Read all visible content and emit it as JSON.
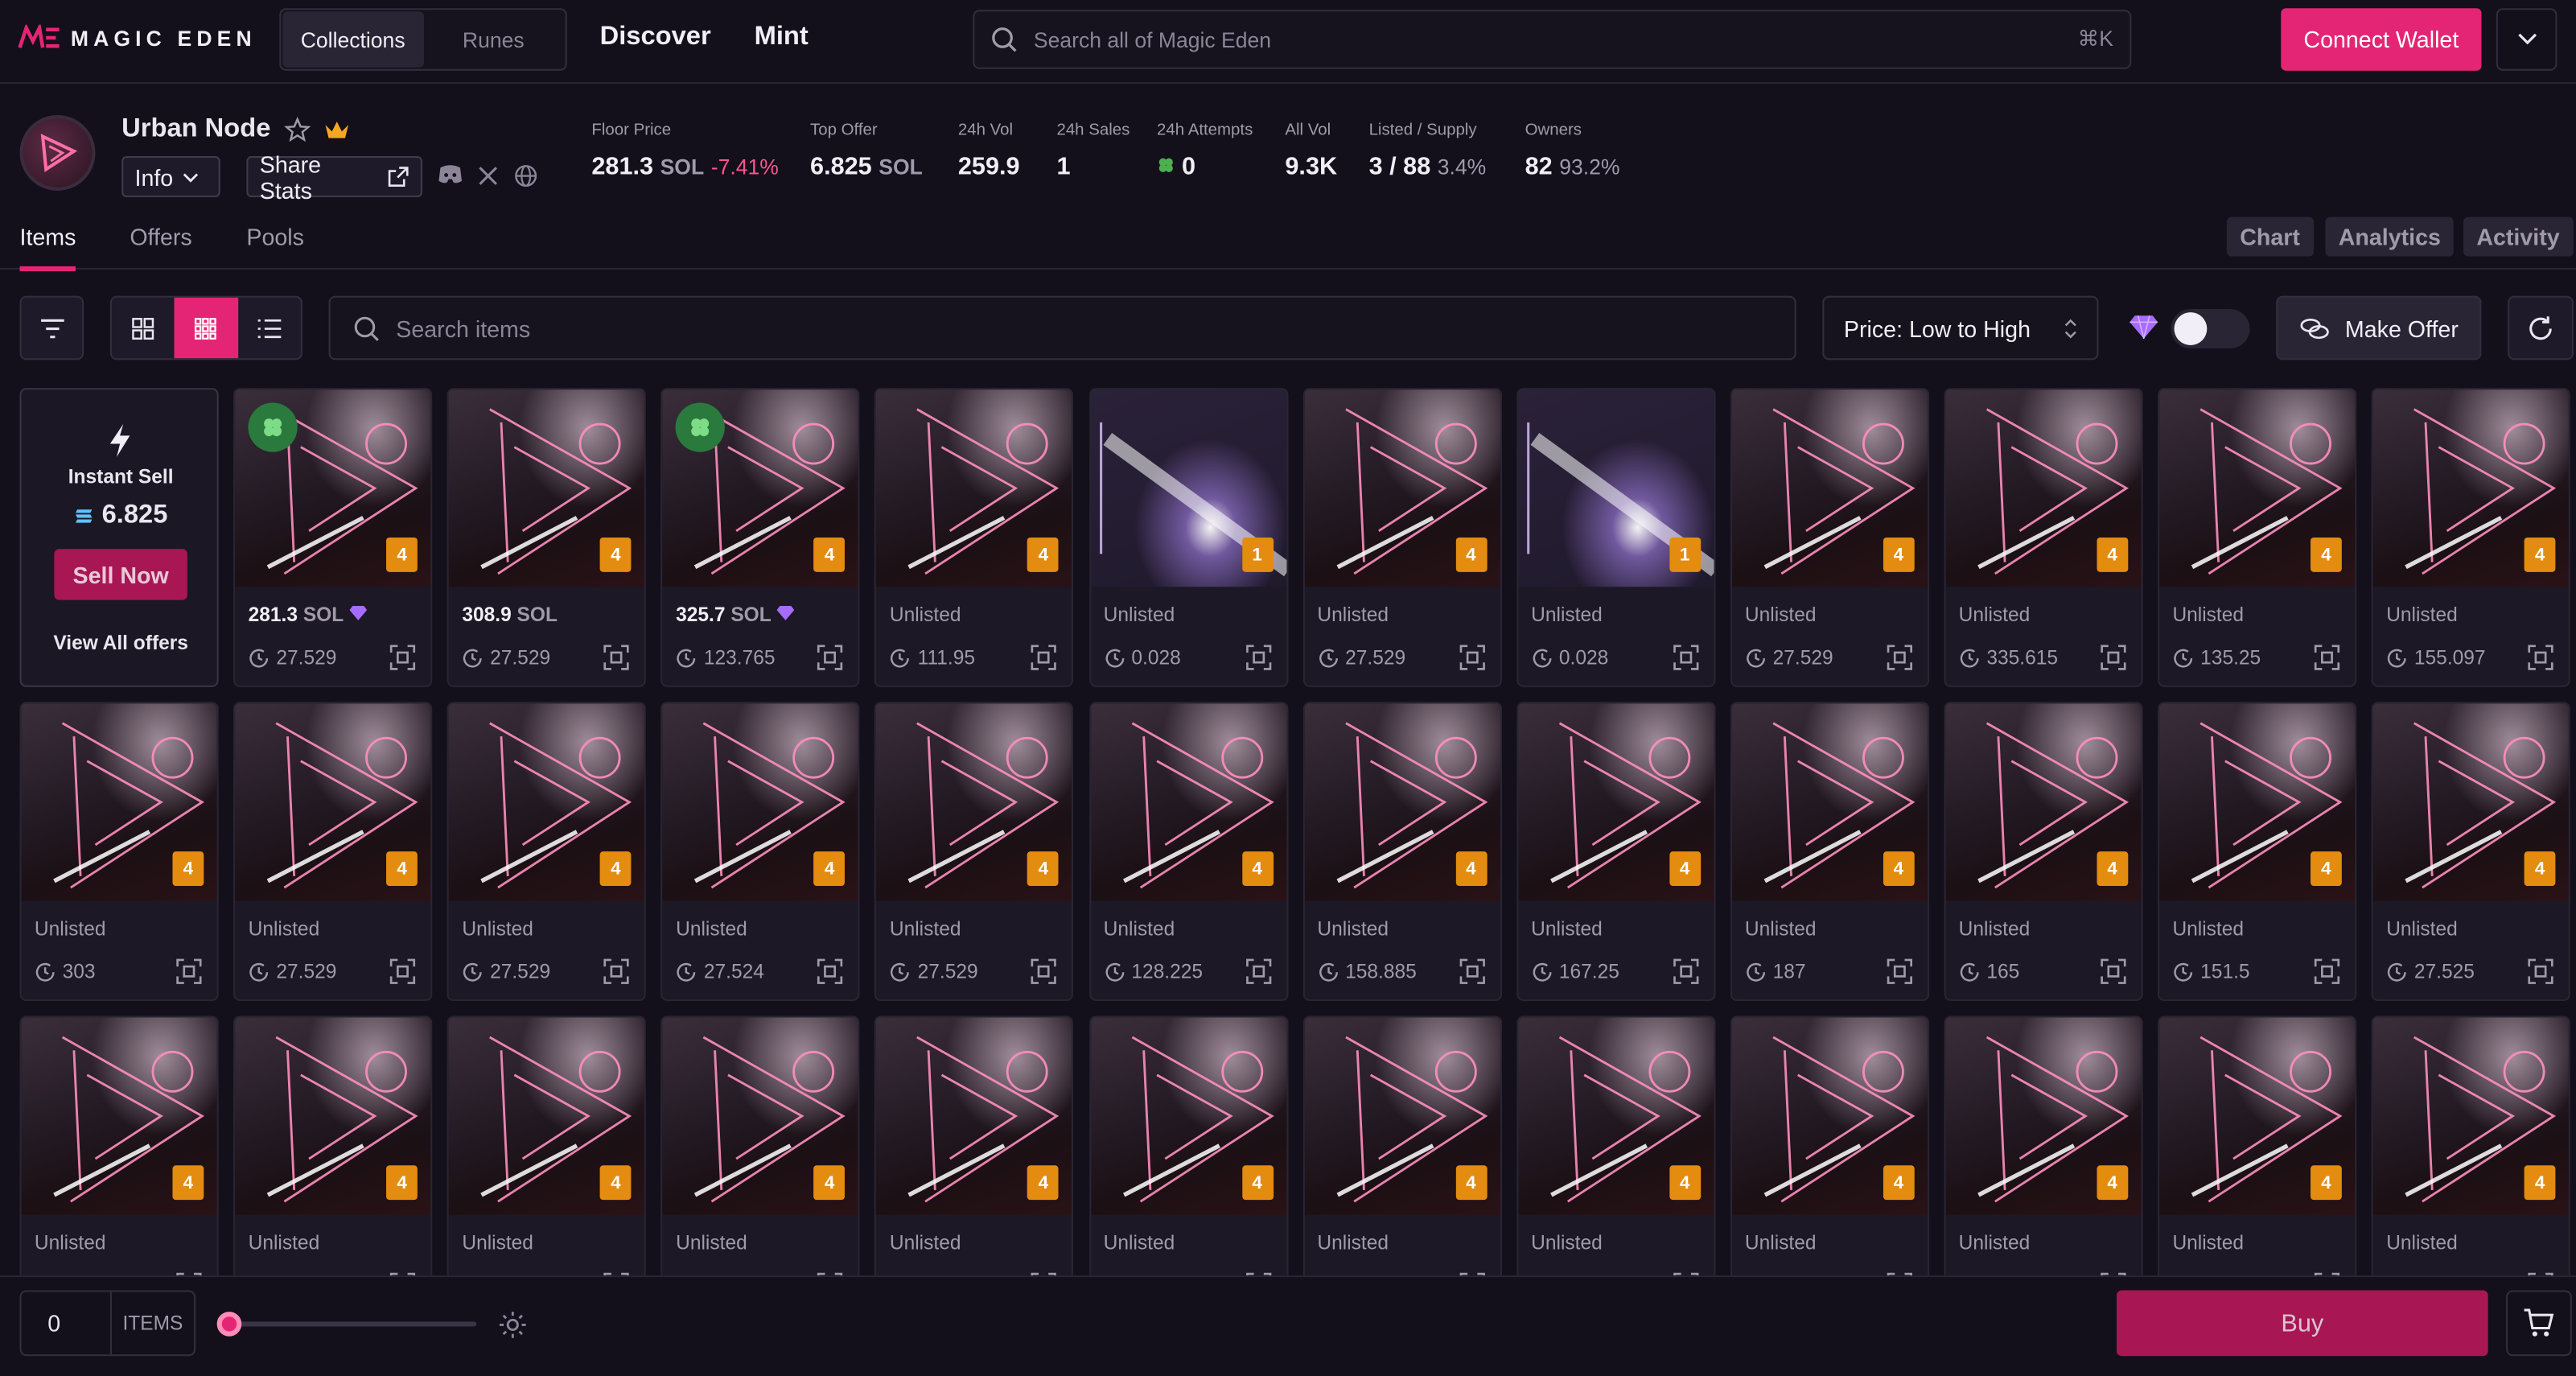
{
  "brand": {
    "name": "MAGIC EDEN"
  },
  "header": {
    "tabs": [
      "Collections",
      "Runes"
    ],
    "nav": [
      "Discover",
      "Mint"
    ],
    "search_placeholder": "Search all of Magic Eden",
    "search_shortcut": "⌘K",
    "connect_wallet": "Connect Wallet"
  },
  "collection": {
    "name": "Urban Node",
    "info_label": "Info",
    "share_label": "Share Stats",
    "stats": [
      {
        "label": "Floor Price",
        "value": "281.3",
        "unit": "SOL",
        "change": "-7.41%"
      },
      {
        "label": "Top Offer",
        "value": "6.825",
        "unit": "SOL"
      },
      {
        "label": "24h Vol",
        "value": "259.9"
      },
      {
        "label": "24h Sales",
        "value": "1"
      },
      {
        "label": "24h Attempts",
        "value": "0"
      },
      {
        "label": "All Vol",
        "value": "9.3K"
      },
      {
        "label": "Listed / Supply",
        "value": "3 / 88",
        "extra": "3.4%"
      },
      {
        "label": "Owners",
        "value": "82",
        "extra": "93.2%"
      }
    ]
  },
  "tabs": [
    "Items",
    "Offers",
    "Pools"
  ],
  "right_tabs": [
    "Chart",
    "Analytics",
    "Activity"
  ],
  "toolbar": {
    "search_placeholder": "Search items",
    "sort": "Price: Low to High",
    "make_offer": "Make Offer"
  },
  "instant_sell": {
    "title": "Instant Sell",
    "value": "6.825",
    "button": "Sell Now",
    "link": "View All offers"
  },
  "items": [
    {
      "price": "281.3",
      "unit": "SOL",
      "diamond": true,
      "badge": true,
      "rank": "4",
      "last": "27.529",
      "beam": false
    },
    {
      "price": "308.9",
      "unit": "SOL",
      "diamond": false,
      "badge": false,
      "rank": "4",
      "last": "27.529",
      "beam": false
    },
    {
      "price": "325.7",
      "unit": "SOL",
      "diamond": true,
      "badge": true,
      "rank": "4",
      "last": "123.765",
      "beam": false
    },
    {
      "price": "Unlisted",
      "rank": "4",
      "last": "111.95",
      "beam": false
    },
    {
      "price": "Unlisted",
      "rank": "1",
      "last": "0.028",
      "beam": true
    },
    {
      "price": "Unlisted",
      "rank": "4",
      "last": "27.529",
      "beam": false
    },
    {
      "price": "Unlisted",
      "rank": "1",
      "last": "0.028",
      "beam": true
    },
    {
      "price": "Unlisted",
      "rank": "4",
      "last": "27.529",
      "beam": false
    },
    {
      "price": "Unlisted",
      "rank": "4",
      "last": "335.615",
      "beam": false
    },
    {
      "price": "Unlisted",
      "rank": "4",
      "last": "135.25",
      "beam": false
    },
    {
      "price": "Unlisted",
      "rank": "4",
      "last": "155.097",
      "beam": false
    },
    {
      "price": "Unlisted",
      "rank": "4",
      "last": "303",
      "beam": false
    },
    {
      "price": "Unlisted",
      "rank": "4",
      "last": "27.529",
      "beam": false
    },
    {
      "price": "Unlisted",
      "rank": "4",
      "last": "27.529",
      "beam": false
    },
    {
      "price": "Unlisted",
      "rank": "4",
      "last": "27.524",
      "beam": false
    },
    {
      "price": "Unlisted",
      "rank": "4",
      "last": "27.529",
      "beam": false
    },
    {
      "price": "Unlisted",
      "rank": "4",
      "last": "128.225",
      "beam": false
    },
    {
      "price": "Unlisted",
      "rank": "4",
      "last": "158.885",
      "beam": false
    },
    {
      "price": "Unlisted",
      "rank": "4",
      "last": "167.25",
      "beam": false
    },
    {
      "price": "Unlisted",
      "rank": "4",
      "last": "187",
      "beam": false
    },
    {
      "price": "Unlisted",
      "rank": "4",
      "last": "165",
      "beam": false
    },
    {
      "price": "Unlisted",
      "rank": "4",
      "last": "151.5",
      "beam": false
    },
    {
      "price": "Unlisted",
      "rank": "4",
      "last": "27.525",
      "beam": false
    },
    {
      "price": "Unlisted",
      "rank": "4",
      "last": "",
      "beam": false
    },
    {
      "price": "Unlisted",
      "rank": "4",
      "last": "",
      "beam": false
    },
    {
      "price": "Unlisted",
      "rank": "4",
      "last": "",
      "beam": false
    },
    {
      "price": "Unlisted",
      "rank": "4",
      "last": "",
      "beam": false
    },
    {
      "price": "Unlisted",
      "rank": "4",
      "last": "",
      "beam": false
    },
    {
      "price": "Unlisted",
      "rank": "4",
      "last": "",
      "beam": false
    },
    {
      "price": "Unlisted",
      "rank": "4",
      "last": "",
      "beam": false
    },
    {
      "price": "Unlisted",
      "rank": "4",
      "last": "",
      "beam": false
    },
    {
      "price": "Unlisted",
      "rank": "4",
      "last": "",
      "beam": false
    },
    {
      "price": "Unlisted",
      "rank": "4",
      "last": "",
      "beam": false
    },
    {
      "price": "Unlisted",
      "rank": "4",
      "last": "",
      "beam": false
    },
    {
      "price": "Unlisted",
      "rank": "4",
      "last": "",
      "beam": false
    }
  ],
  "footer": {
    "qty": "0",
    "items_label": "ITEMS",
    "buy": "Buy"
  },
  "colors": {
    "accent": "#e42575",
    "rank": "#e38c0f",
    "bg": "#130f1b"
  }
}
